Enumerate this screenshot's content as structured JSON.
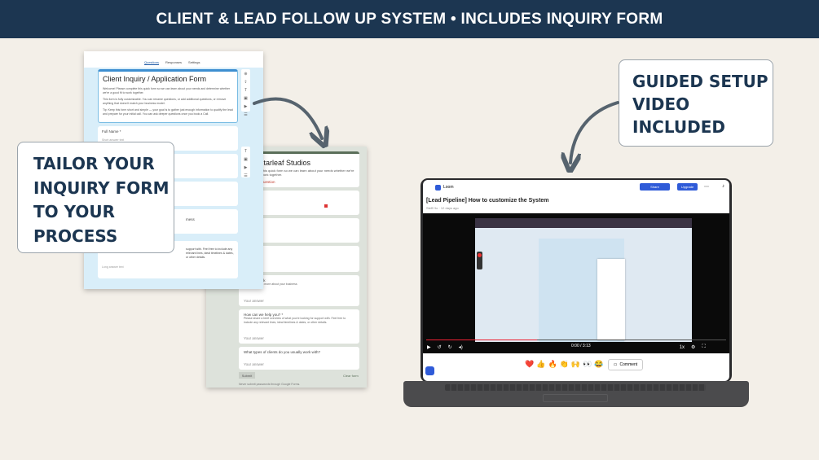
{
  "banner": {
    "text": "CLIENT & LEAD FOLLOW UP SYSTEM • INCLUDES INQUIRY FORM"
  },
  "callouts": {
    "left": [
      "TAILOR YOUR",
      "INQUIRY FORM",
      "TO YOUR",
      "PROCESS"
    ],
    "right": [
      "GUIDED SETUP",
      "VIDEO",
      "INCLUDED"
    ]
  },
  "front_form": {
    "tabs": [
      "Questions",
      "Responses",
      "Settings"
    ],
    "title": "Client Inquiry / Application Form",
    "paragraphs": [
      "Welcome! Please complete this quick form so we can learn about your needs and determine whether we're a good fit to work together.",
      "This form is fully customizable. You can rename questions, or add additional questions, or remove anything that doesn't match your business model.",
      "Tip: Keep this form short and simple — your goal is to gather just enough information to qualify the lead and prepare for your initial call. You can ask deeper questions once you book a Call."
    ],
    "fields": [
      {
        "label": "Full Name *",
        "answer": "Short answer text"
      },
      {
        "label": "",
        "answer": ""
      },
      {
        "label": "",
        "answer": ""
      },
      {
        "label": "mess",
        "answer": ""
      },
      {
        "label": "support with. Feel free to include any relevant lines, ideal timelines & dates, or other details.",
        "answer": "Long answer text"
      }
    ]
  },
  "back_form": {
    "title": "with Starleaf Studios",
    "intro": "se complete this quick form so we can learn about your needs whether we're a good fit to work together.",
    "required": "a required question",
    "fields": [
      {
        "label": "",
        "answer": ""
      },
      {
        "label": "s *",
        "answer": ""
      },
      {
        "label": "ne",
        "answer": ""
      },
      {
        "label": "al Media Link",
        "answer": "Your answer",
        "sub": "e for us to learn more about your business"
      },
      {
        "label": "How can we help you? *",
        "answer": "Your answer",
        "sub": "Please share a brief overview of what you're looking for support with. Feel free to include any relevant lines, ideal timelines & dates, or other details."
      },
      {
        "label": "What types of clients do you usually work with?",
        "answer": "Your answer"
      }
    ],
    "submit": "Submit",
    "clear": "Clear form",
    "footer": "Never submit passwords through Google Forms."
  },
  "laptop": {
    "app_name": "Loom",
    "share_label": "Share",
    "upgrade_label": "Upgrade",
    "video_title": "[Lead Pipeline] How to customize the System",
    "meta": "Steff Ho · 12 days ago",
    "time": "0:00 / 3:13",
    "progress": 0.37,
    "speed": "1x",
    "reactions": [
      "❤️",
      "👍",
      "🔥",
      "👏",
      "🙌",
      "👀",
      "😂"
    ],
    "comment_label": "Comment"
  },
  "colors": {
    "banner": "#1c3651",
    "background": "#f3efe8",
    "accent": "#2f5bd8"
  }
}
